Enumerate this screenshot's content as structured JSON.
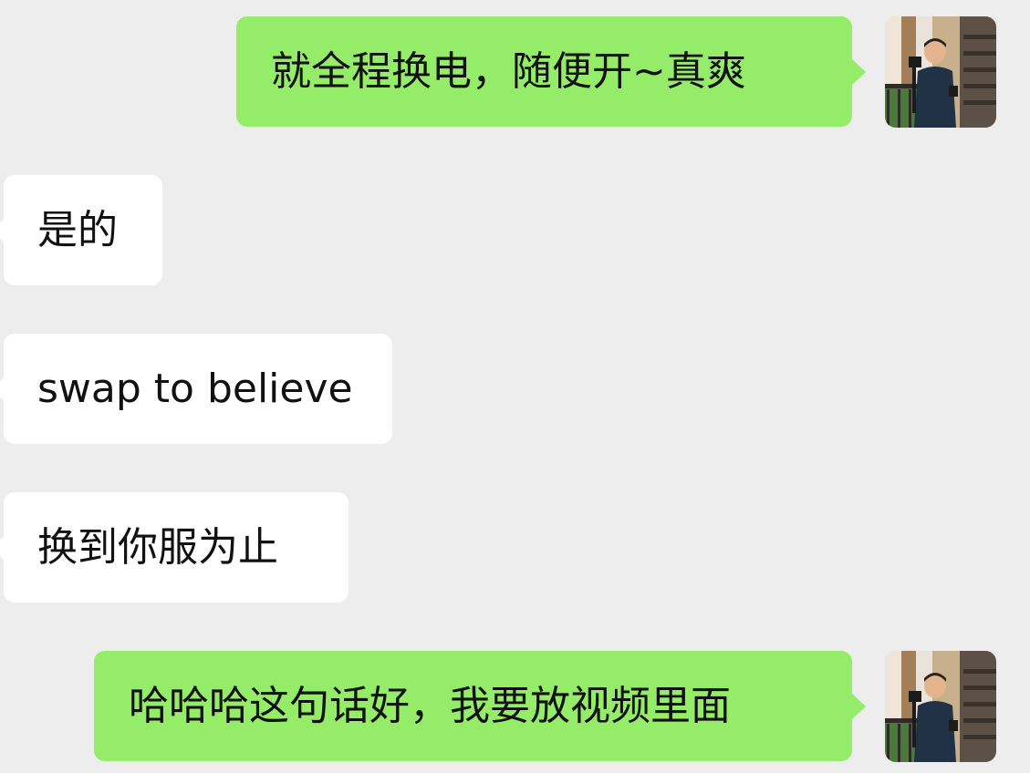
{
  "colors": {
    "background": "#ededed",
    "outgoing_bubble": "#95ec69",
    "incoming_bubble": "#ffffff",
    "text": "#111111"
  },
  "messages": [
    {
      "direction": "outgoing",
      "text": "就全程换电，随便开~真爽",
      "avatar": "user-avatar-photo"
    },
    {
      "direction": "incoming",
      "text": "是的"
    },
    {
      "direction": "incoming",
      "text": "swap to believe"
    },
    {
      "direction": "incoming",
      "text": "换到你服为止"
    },
    {
      "direction": "outgoing",
      "text": "哈哈哈这句话好，我要放视频里面",
      "avatar": "user-avatar-photo"
    }
  ]
}
